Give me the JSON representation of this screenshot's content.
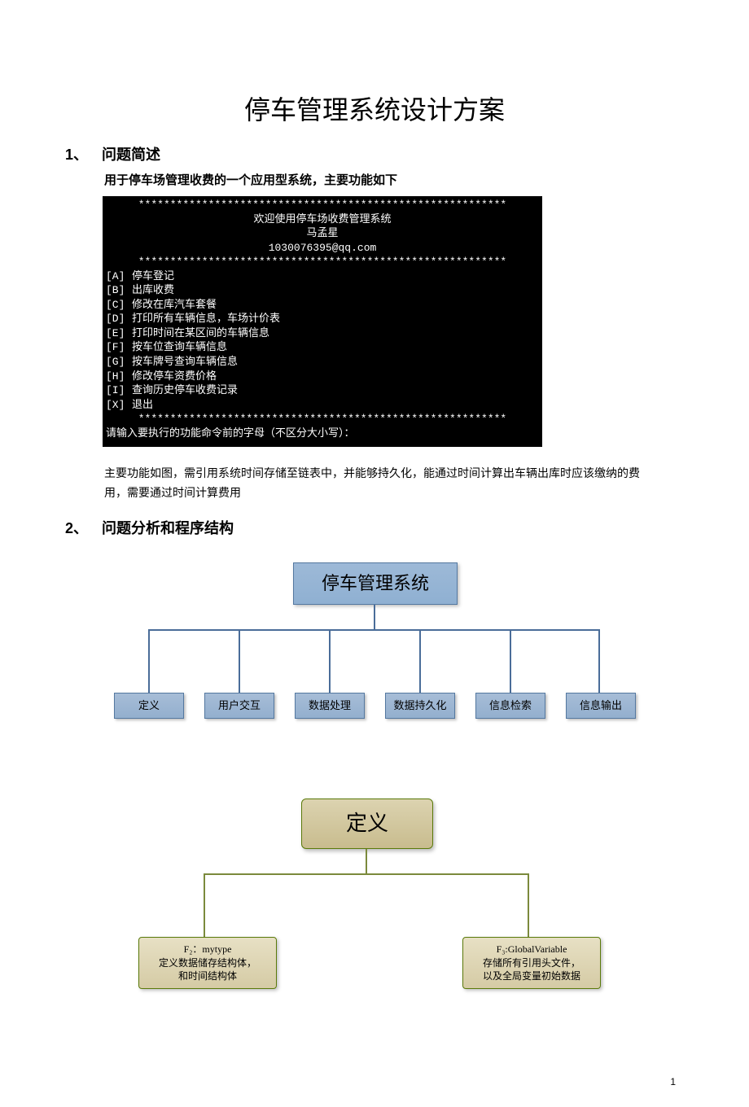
{
  "title": "停车管理系统设计方案",
  "section1": {
    "num": "1、",
    "heading": "问题简述",
    "intro": "用于停车场管理收费的一个应用型系统，主要功能如下"
  },
  "console": {
    "stars": "**********************************************************",
    "welcome": "欢迎使用停车场收费管理系统",
    "author": "马孟星",
    "email": "1030076395@qq.com",
    "menu": [
      {
        "k": "[A]",
        "t": "停车登记"
      },
      {
        "k": "[B]",
        "t": "出库收费"
      },
      {
        "k": "[C]",
        "t": "修改在库汽车套餐"
      },
      {
        "k": "[D]",
        "t": "打印所有车辆信息，车场计价表"
      },
      {
        "k": "[E]",
        "t": "打印时间在某区间的车辆信息"
      },
      {
        "k": "[F]",
        "t": "按车位查询车辆信息"
      },
      {
        "k": "[G]",
        "t": "按车牌号查询车辆信息"
      },
      {
        "k": "[H]",
        "t": "修改停车资费价格"
      },
      {
        "k": "[I]",
        "t": "查询历史停车收费记录"
      },
      {
        "k": "[X]",
        "t": "退出"
      }
    ],
    "prompt": "请输入要执行的功能命令前的字母（不区分大小写）："
  },
  "body": "主要功能如图，需引用系统时间存储至链表中，并能够持久化，能通过时间计算出车辆出库时应该缴纳的费用，需要通过时间计算费用",
  "section2": {
    "num": "2、",
    "heading": "问题分析和程序结构"
  },
  "chart_data": [
    {
      "type": "tree",
      "title": "",
      "root": "停车管理系统",
      "children": [
        "定义",
        "用户交互",
        "数据处理",
        "数据持久化",
        "信息检索",
        "信息输出"
      ]
    },
    {
      "type": "tree",
      "title": "",
      "root": "定义",
      "children": [
        {
          "name": "F₂：mytype",
          "desc1": "定义数据储存结构体，",
          "desc2": "和时间结构体"
        },
        {
          "name": "F₃:GlobalVariable",
          "desc1": "存储所有引用头文件，",
          "desc2": "以及全局变量初始数据"
        }
      ]
    }
  ],
  "pageNumber": "1"
}
